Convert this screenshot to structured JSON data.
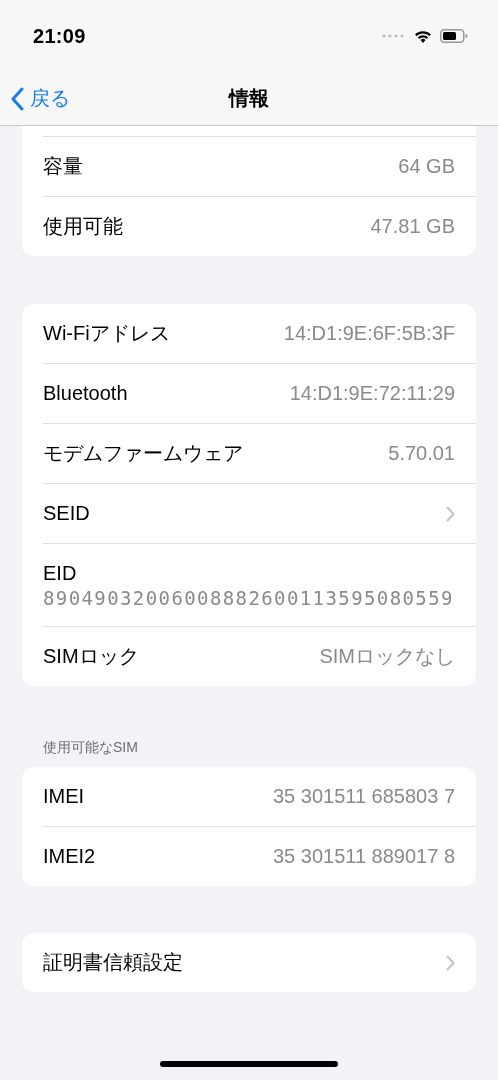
{
  "status_bar": {
    "time": "21:09"
  },
  "nav": {
    "back": "戻る",
    "title": "情報"
  },
  "groups": [
    {
      "clipped_top": true,
      "rows": [
        {
          "kind": "value",
          "label": "容量",
          "value": "64 GB"
        },
        {
          "kind": "value",
          "label": "使用可能",
          "value": "47.81 GB"
        }
      ]
    },
    {
      "rows": [
        {
          "kind": "value",
          "label": "Wi-Fiアドレス",
          "value": "14:D1:9E:6F:5B:3F"
        },
        {
          "kind": "value",
          "label": "Bluetooth",
          "value": "14:D1:9E:72:11:29"
        },
        {
          "kind": "value",
          "label": "モデムファームウェア",
          "value": "5.70.01"
        },
        {
          "kind": "chevron",
          "label": "SEID"
        },
        {
          "kind": "stacked",
          "label": "EID",
          "value": "89049032006008882600113595080559"
        },
        {
          "kind": "value",
          "label": "SIMロック",
          "value": "SIMロックなし"
        }
      ]
    },
    {
      "header": "使用可能なSIM",
      "rows": [
        {
          "kind": "value",
          "label": "IMEI",
          "value": "35 301511 685803 7"
        },
        {
          "kind": "value",
          "label": "IMEI2",
          "value": "35 301511 889017 8"
        }
      ]
    },
    {
      "rows": [
        {
          "kind": "chevron",
          "label": "証明書信頼設定"
        }
      ]
    }
  ]
}
